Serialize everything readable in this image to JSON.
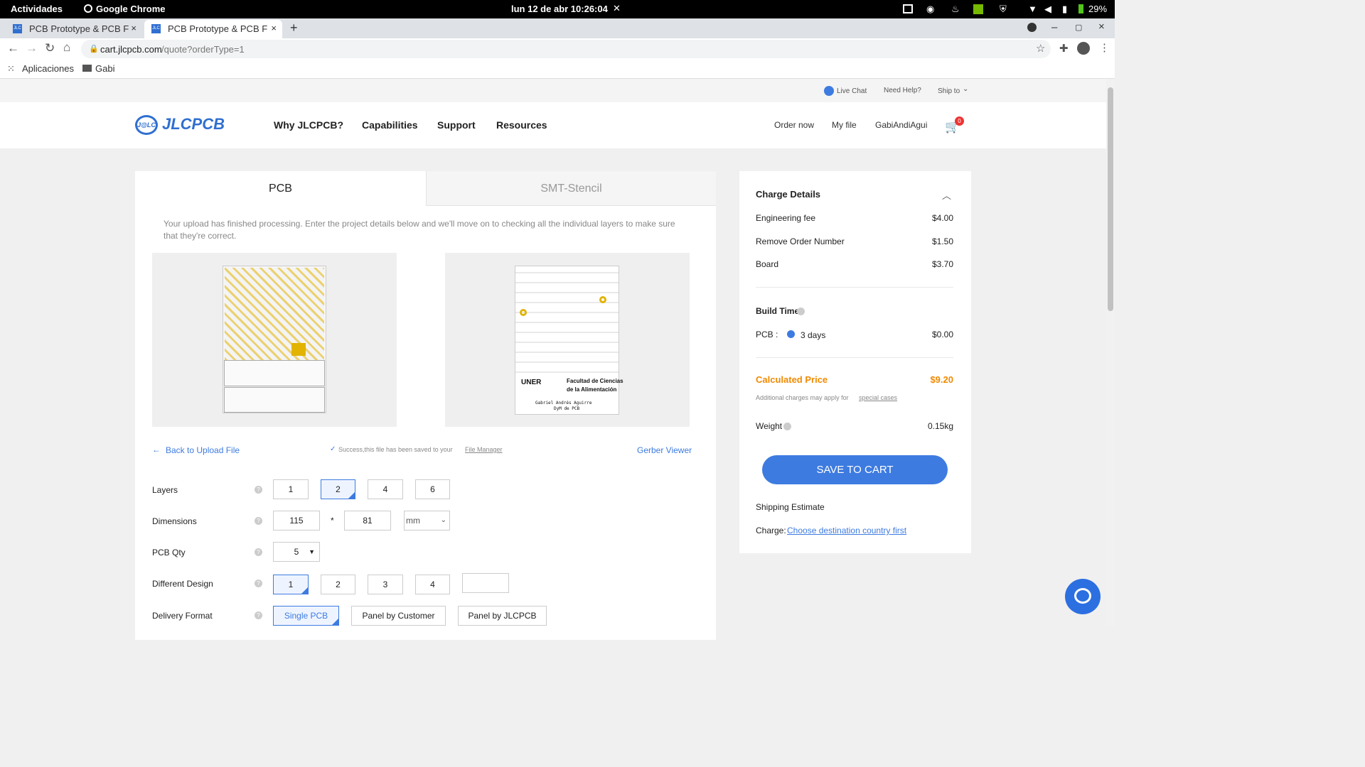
{
  "os": {
    "activities": "Actividades",
    "app": "Google Chrome",
    "clock": "lun 12 de abr  10:26:04",
    "battery": "29%"
  },
  "browser": {
    "tabs": [
      {
        "title": "PCB Prototype & PCB Fab"
      },
      {
        "title": "PCB Prototype & PCB Fab"
      }
    ],
    "url_host": "cart.jlcpcb.com",
    "url_path": "/quote?orderType=1",
    "bookmarks": [
      "Aplicaciones",
      "Gabi"
    ]
  },
  "util": {
    "live_chat": "Live Chat",
    "need_help": "Need Help?",
    "ship_to": "Ship to"
  },
  "header": {
    "logo_prefix": "J@LC",
    "logo": "JLCPCB",
    "nav": [
      "Why JLCPCB?",
      "Capabilities",
      "Support",
      "Resources"
    ],
    "order_now": "Order now",
    "my_file": "My file",
    "user": "GabiAndiAgui",
    "cart_count": "0"
  },
  "main": {
    "tab_pcb": "PCB",
    "tab_smt": "SMT-Stencil",
    "message": "Your upload has finished processing. Enter the project details below and we'll move on to checking all the individual layers to make sure that they're correct.",
    "board_text_1": "Facultad de Ciencias",
    "board_text_2": "de la Alimentación",
    "board_uner": "UNER",
    "board_author": "Gabriel Andrés Aguirre",
    "board_sub": "DyM de PCB",
    "back": "Back to Upload File",
    "success": "Success,this file has been saved to your",
    "file_manager": "File Manager",
    "gerber": "Gerber Viewer"
  },
  "form": {
    "layers": {
      "label": "Layers",
      "options": [
        "1",
        "2",
        "4",
        "6"
      ],
      "selected": "2"
    },
    "dimensions": {
      "label": "Dimensions",
      "width": "115",
      "sep": "*",
      "height": "81",
      "unit": "mm"
    },
    "qty": {
      "label": "PCB Qty",
      "value": "5"
    },
    "design": {
      "label": "Different Design",
      "options": [
        "1",
        "2",
        "3",
        "4"
      ],
      "selected": "1"
    },
    "delivery": {
      "label": "Delivery Format",
      "options": [
        "Single PCB",
        "Panel by Customer",
        "Panel by JLCPCB"
      ],
      "selected": "Single PCB"
    }
  },
  "charges": {
    "title": "Charge Details",
    "items": [
      {
        "name": "Engineering fee",
        "value": "$4.00"
      },
      {
        "name": "Remove Order Number",
        "value": "$1.50"
      },
      {
        "name": "Board",
        "value": "$3.70"
      }
    ],
    "build_title": "Build Time",
    "build_label": "PCB :",
    "build_option": "3 days",
    "build_price": "$0.00",
    "calc_label": "Calculated Price",
    "calc_value": "$9.20",
    "note": "Additional charges may apply for",
    "note_link": "special cases",
    "weight_label": "Weight",
    "weight_value": "0.15kg",
    "save": "SAVE TO CART",
    "ship_est": "Shipping Estimate",
    "charge_label": "Charge:",
    "charge_link": "Choose destination country first"
  },
  "colors": {
    "accent": "#3d7be0",
    "orange": "#f08a00",
    "gold": "#e2b300"
  }
}
